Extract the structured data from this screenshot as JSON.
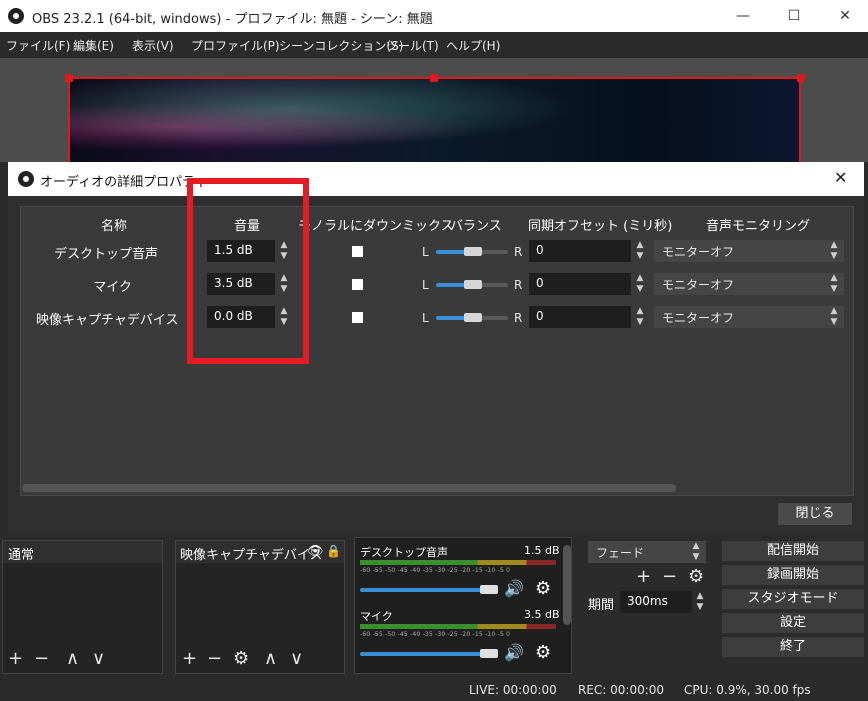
{
  "window": {
    "title": "OBS 23.2.1 (64-bit, windows) - プロファイル: 無題 - シーン: 無題",
    "minimize": "—",
    "maximize": "☐",
    "close": "✕"
  },
  "menu": [
    "ファイル(F)",
    "編集(E)",
    "表示(V)",
    "プロファイル(P)",
    "シーンコレクション(S)",
    "ツール(T)",
    "ヘルプ(H)"
  ],
  "dialog": {
    "title": "オーディオの詳細プロパティ",
    "close": "✕",
    "columns": [
      "名称",
      "音量",
      "モノラルにダウンミックス",
      "バランス",
      "同期オフセット (ミリ秒)",
      "音声モニタリング"
    ],
    "rows": [
      {
        "name": "デスクトップ音声",
        "volume": "1.5 dB",
        "mono": true,
        "balance_l": "L",
        "balance_r": "R",
        "balance": 0.5,
        "offset": "0",
        "monitor": "モニターオフ"
      },
      {
        "name": "マイク",
        "volume": "3.5 dB",
        "mono": true,
        "balance_l": "L",
        "balance_r": "R",
        "balance": 0.5,
        "offset": "0",
        "monitor": "モニターオフ"
      },
      {
        "name": "映像キャプチャデバイス",
        "volume": "0.0 dB",
        "mono": true,
        "balance_l": "L",
        "balance_r": "R",
        "balance": 0.5,
        "offset": "0",
        "monitor": "モニターオフ"
      }
    ],
    "close_button": "閉じる"
  },
  "scenes": {
    "item": "通常"
  },
  "sources": {
    "item": "映像キャプチャデバイス"
  },
  "mixer": {
    "channels": [
      {
        "name": "デスクトップ音声",
        "level": "1.5 dB"
      },
      {
        "name": "マイク",
        "level": "3.5 dB"
      }
    ],
    "ticks": "-60 -55 -50 -45 -40 -35 -30 -25 -20 -15 -10 -5 0"
  },
  "transitions": {
    "type": "フェード",
    "duration_label": "期間",
    "duration": "300ms"
  },
  "controls": [
    "配信開始",
    "録画開始",
    "スタジオモード",
    "設定",
    "終了"
  ],
  "status": {
    "live": "LIVE: 00:00:00",
    "rec": "REC: 00:00:00",
    "cpu": "CPU: 0.9%, 30.00 fps"
  },
  "colors": {
    "highlight": "#e51c23",
    "accent": "#3a8fd8"
  }
}
